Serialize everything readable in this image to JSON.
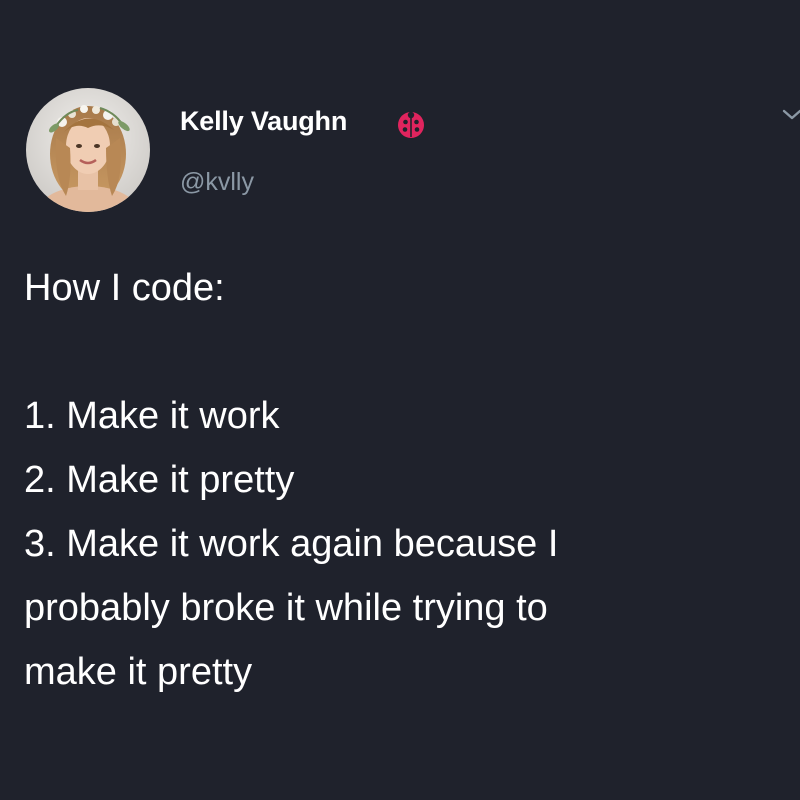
{
  "author": {
    "display_name": "Kelly Vaughn",
    "handle": "@kvlly",
    "badge_icon": "ladybug-badge-icon",
    "avatar_icon": "profile-photo-avatar"
  },
  "menu": {
    "icon": "chevron-down-icon"
  },
  "tweet": {
    "lines": [
      "How I code:",
      "",
      "1. Make it work",
      "2. Make it pretty",
      "3. Make it work again because I",
      "probably broke it while trying to",
      "make it pretty"
    ]
  },
  "colors": {
    "background": "#1f222c",
    "text": "#ffffff",
    "handle": "#8b98a5",
    "badge": "#e0245e"
  }
}
